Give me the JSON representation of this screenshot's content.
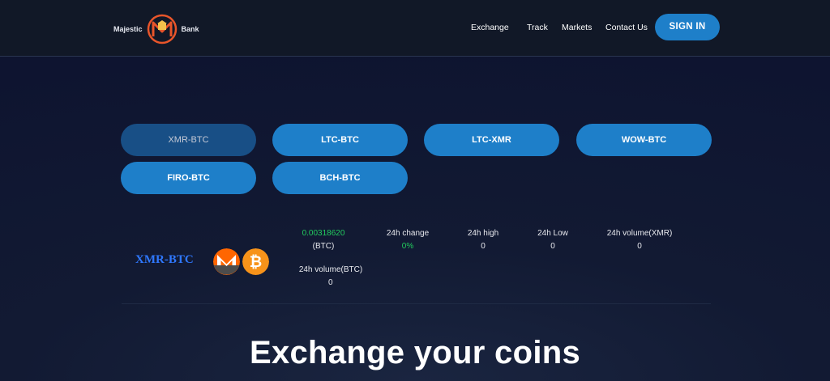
{
  "header": {
    "logo_left": "Majestic",
    "logo_right": "Bank",
    "nav": [
      "Exchange",
      "Track",
      "Markets",
      "Contact Us"
    ],
    "signin_label": "SIGN IN"
  },
  "pairs": [
    {
      "label": "XMR-BTC",
      "active": true
    },
    {
      "label": "LTC-BTC",
      "active": false
    },
    {
      "label": "LTC-XMR",
      "active": false
    },
    {
      "label": "WOW-BTC",
      "active": false
    },
    {
      "label": "FIRO-BTC",
      "active": false
    },
    {
      "label": "BCH-BTC",
      "active": false
    }
  ],
  "market": {
    "pair": "XMR-BTC",
    "price": "0.00318620",
    "price_unit": "(BTC)",
    "change_label": "24h change",
    "change_value": "0%",
    "high_label": "24h high",
    "high_value": "0",
    "low_label": "24h Low",
    "low_value": "0",
    "vol_xmr_label": "24h volume(XMR)",
    "vol_xmr_value": "0",
    "vol_btc_label": "24h volume(BTC)",
    "vol_btc_value": "0",
    "coins": [
      "monero-icon",
      "bitcoin-icon"
    ],
    "colors": {
      "positive": "#22cc5e",
      "accent": "#1e7fc9",
      "pair_title": "#2f78ff"
    }
  },
  "hero": {
    "headline": "Exchange your coins"
  }
}
